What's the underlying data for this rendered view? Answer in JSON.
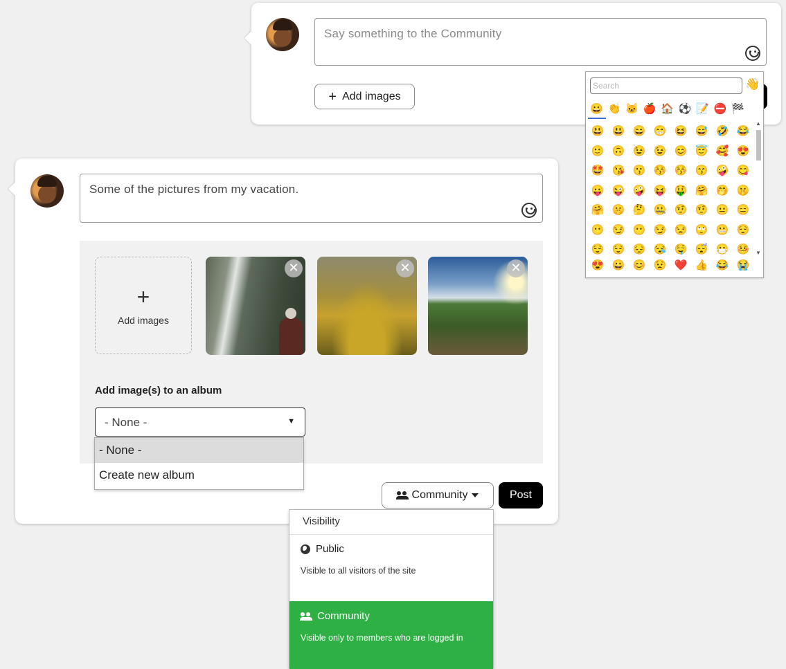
{
  "top_composer": {
    "placeholder": "Say something to the Community",
    "add_images_label": "Add images"
  },
  "emoji_picker": {
    "search_placeholder": "Search",
    "tone_emoji": "👋",
    "categories": [
      "😀",
      "👏",
      "🐱",
      "🍎",
      "🏠",
      "⚽",
      "📝",
      "⛔",
      "🏁"
    ],
    "emojis": [
      "😃",
      "😃",
      "😄",
      "😁",
      "😆",
      "😅",
      "🤣",
      "😂",
      "🙂",
      "🙃",
      "😉",
      "😉",
      "😊",
      "😇",
      "🥰",
      "😍",
      "🤩",
      "😘",
      "😗",
      "😚",
      "😚",
      "😙",
      "🤪",
      "😋",
      "😛",
      "😜",
      "🤪",
      "😝",
      "🤑",
      "🤗",
      "🤭",
      "🤫",
      "🤗",
      "🤫",
      "🤔",
      "🤐",
      "🤨",
      "🤨",
      "😐",
      "😑",
      "😶",
      "😏",
      "😶",
      "😏",
      "😒",
      "🙄",
      "😬",
      "😌",
      "😌",
      "😌",
      "😔",
      "😪",
      "🤤",
      "😴",
      "😷",
      "🤒"
    ],
    "recent": [
      "😍",
      "😀",
      "😊",
      "😟",
      "❤️",
      "👍",
      "😂",
      "😭"
    ]
  },
  "main_composer": {
    "text": "Some of the pictures from my vacation.",
    "add_images_label": "Add images",
    "images": [
      {
        "alt": "waterfall",
        "remove": "✕"
      },
      {
        "alt": "grapes",
        "remove": "✕"
      },
      {
        "alt": "vineyard",
        "remove": "✕"
      }
    ],
    "album_label": "Add image(s) to an album",
    "album_selected": "- None -",
    "album_options": [
      "- None -",
      "Create new album"
    ],
    "visibility_button": "Community",
    "post_label": "Post"
  },
  "visibility_menu": {
    "header": "Visibility",
    "options": [
      {
        "title": "Public",
        "description": "Visible to all visitors of the site"
      },
      {
        "title": "Community",
        "description": "Visible only to members who are logged in"
      }
    ]
  },
  "colors": {
    "accent_green": "#2fb045",
    "post_button": "#000000"
  }
}
